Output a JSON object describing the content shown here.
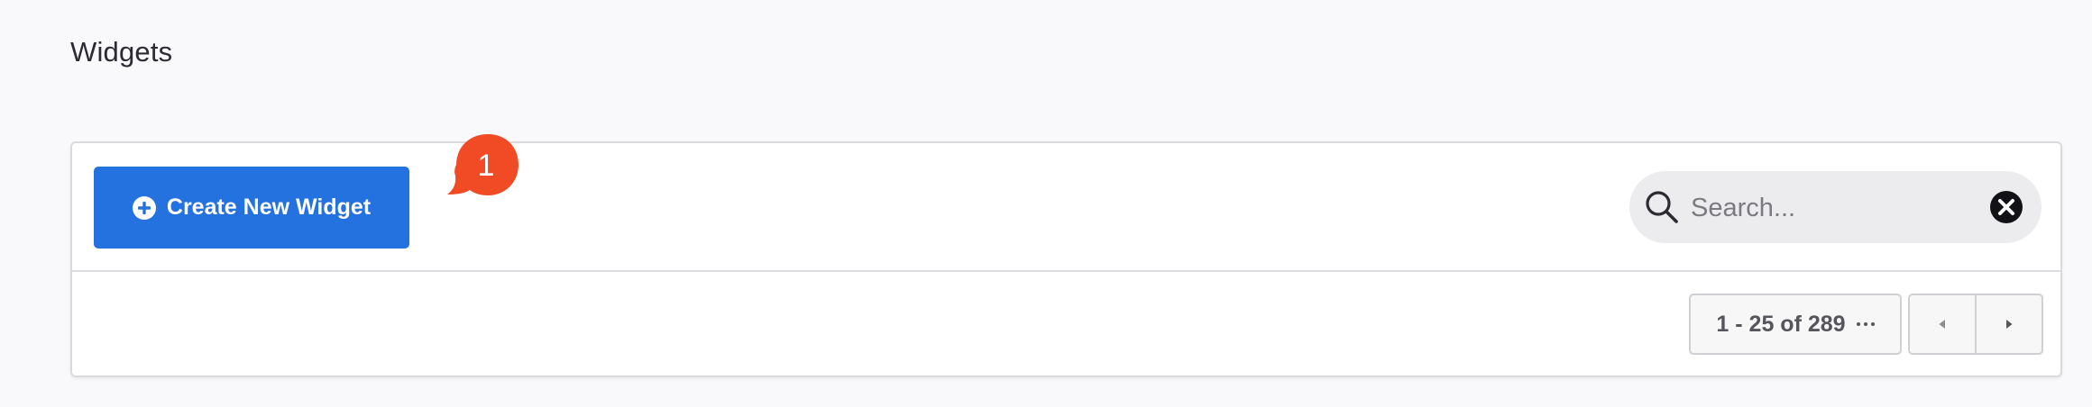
{
  "page": {
    "title": "Widgets"
  },
  "toolbar": {
    "create_label": "Create New Widget",
    "create_icon": "plus-circle-icon",
    "badge_count": "1",
    "badge_color": "#f04b24",
    "accent_color": "#2471e0"
  },
  "search": {
    "placeholder": "Search...",
    "value": "",
    "icon": "search-icon",
    "clear_icon": "clear-icon"
  },
  "pagination": {
    "range_label": "1 - 25 of 289",
    "more_icon": "more-horizontal-icon",
    "prev_icon": "triangle-left-icon",
    "next_icon": "triangle-right-icon"
  }
}
